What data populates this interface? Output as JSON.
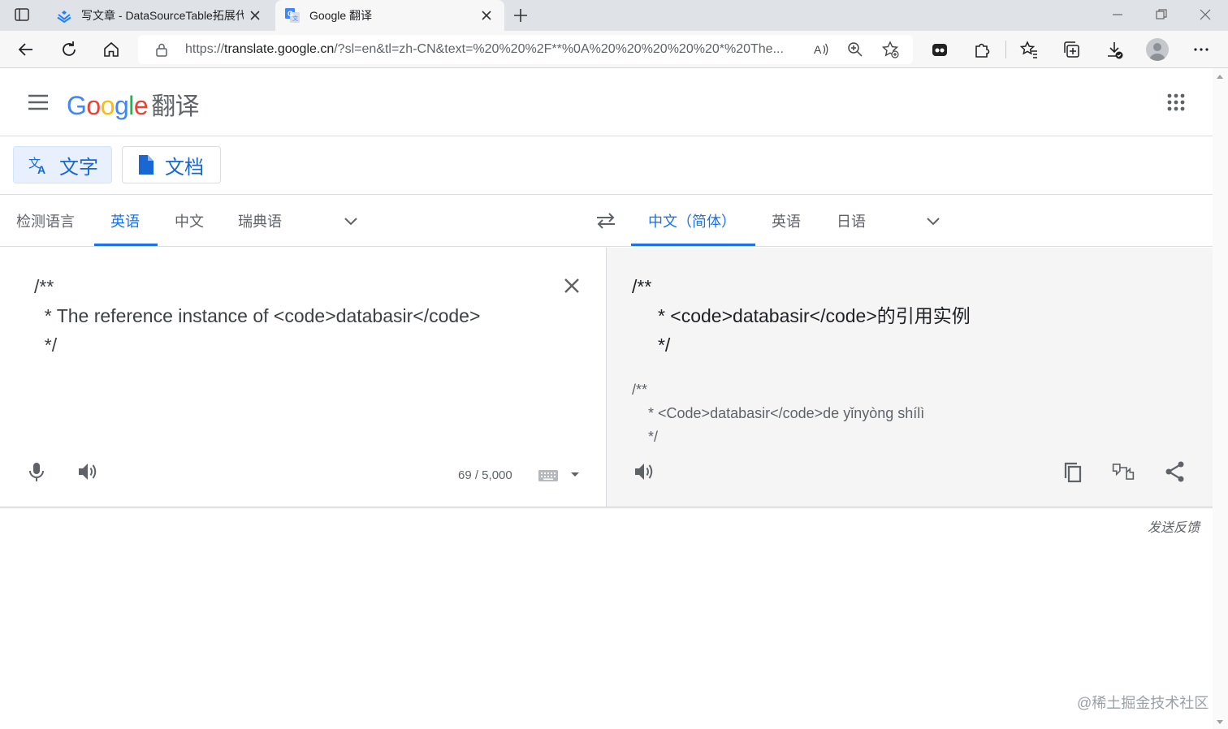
{
  "browser": {
    "tabs": [
      {
        "title": "写文章 - DataSourceTable拓展代",
        "active": false
      },
      {
        "title": "Google 翻译",
        "active": true
      }
    ],
    "url_host_prefix": "https://",
    "url_host": "translate.google.cn",
    "url_rest": "/?sl=en&tl=zh-CN&text=%20%20%2F**%0A%20%20%20%20%20*%20The..."
  },
  "header": {
    "logo_letters": [
      "G",
      "o",
      "o",
      "g",
      "l",
      "e"
    ],
    "product": "翻译"
  },
  "modes": {
    "text_label": "文字",
    "doc_label": "文档"
  },
  "source_langs": [
    "检测语言",
    "英语",
    "中文",
    "瑞典语"
  ],
  "target_langs": [
    "中文（简体）",
    "英语",
    "日语"
  ],
  "source": {
    "text": "/**\n  * The reference instance of <code>databasir</code>\n  */",
    "char_count": "69 / 5,000"
  },
  "target": {
    "text": "/**\n     * <code>databasir</code>的引用实例\n     */",
    "transliteration": "/**\n    * <Code>databasir</code>de yǐnyòng shílì\n    */"
  },
  "footer": {
    "feedback": "发送反馈",
    "watermark": "@稀土掘金技术社区"
  }
}
